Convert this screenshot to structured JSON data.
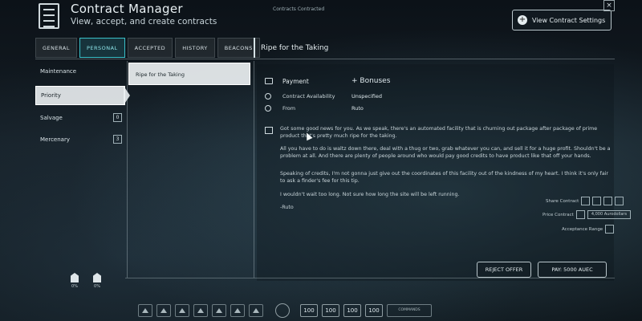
{
  "header": {
    "title": "Contract Manager",
    "subtitle": "View, accept, and create contracts",
    "center_text": "Contracts Contracted",
    "view_settings_label": "View Contract Settings",
    "close_label": "×"
  },
  "tabs": [
    {
      "label": "GENERAL"
    },
    {
      "label": "PERSONAL"
    },
    {
      "label": "ACCEPTED"
    },
    {
      "label": "HISTORY"
    },
    {
      "label": "BEACONS"
    }
  ],
  "subheader": "Ripe for the Taking",
  "nav": [
    {
      "label": "Maintenance",
      "badge": ""
    },
    {
      "label": "Priority",
      "badge": ""
    },
    {
      "label": "Salvage",
      "badge": "0"
    },
    {
      "label": "Mercenary",
      "badge": "3"
    }
  ],
  "contract_list": [
    {
      "title": "Ripe for the Taking"
    }
  ],
  "detail": {
    "payment_label": "Payment",
    "payment_value": "+ Bonuses",
    "availability_label": "Contract Availability",
    "availability_value": "Unspecified",
    "from_label": "From",
    "from_value": "Ruto",
    "paragraphs": [
      "Got some good news for you. As we speak, there's an automated facility that is churning out package after package of prime product that's pretty much ripe for the taking.",
      "All you have to do is waltz down there, deal with a thug or two, grab whatever you can, and sell it for a huge profit. Shouldn't be a problem at all. And there are plenty of people around who would pay good credits to have product like that off your hands.",
      "Speaking of credits, I'm not gonna just give out the coordinates of this facility out of the kindness of my heart. I think it's only fair to ask a finder's fee for this tip.",
      "I wouldn't wait too long. Not sure how long the site will be left running.",
      "-Ruto"
    ]
  },
  "mini_controls": {
    "row1_label": "Share Contract",
    "row2_label": "Price Contract",
    "row2_wide": "4,000 Aurodollars",
    "row3_label": "Acceptance Range"
  },
  "buttons": {
    "reject": "REJECT OFFER",
    "pay": "PAY: 5000 AUEC"
  },
  "indicators": [
    {
      "label": "0%"
    },
    {
      "label": "0%"
    }
  ],
  "toolbar": {
    "numbers": [
      "100",
      "100",
      "100",
      "100"
    ],
    "wide_label": "COMMANDS"
  },
  "colors": {
    "accent": "#39c0c8",
    "text": "#dfe9ee"
  }
}
